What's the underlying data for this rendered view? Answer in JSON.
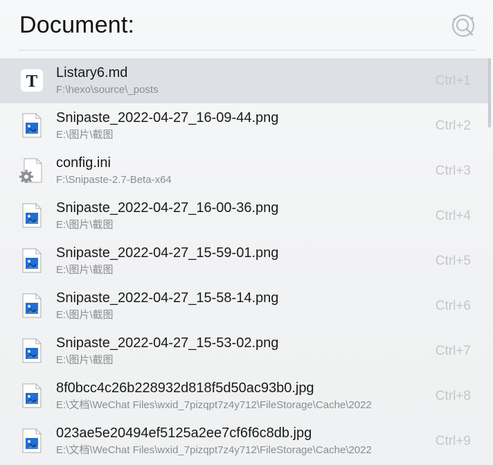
{
  "header": {
    "query_label": "Document:",
    "search_icon": "search-magnifier-icon"
  },
  "results": [
    {
      "name": "Listary6.md",
      "path": "F:\\hexo\\source\\_posts",
      "shortcut": "Ctrl+1",
      "icon": "text-file-icon",
      "selected": true
    },
    {
      "name": "Snipaste_2022-04-27_16-09-44.png",
      "path": "E:\\图片\\截图",
      "shortcut": "Ctrl+2",
      "icon": "image-file-icon"
    },
    {
      "name": "config.ini",
      "path": "F:\\Snipaste-2.7-Beta-x64",
      "shortcut": "Ctrl+3",
      "icon": "config-file-icon"
    },
    {
      "name": "Snipaste_2022-04-27_16-00-36.png",
      "path": "E:\\图片\\截图",
      "shortcut": "Ctrl+4",
      "icon": "image-file-icon"
    },
    {
      "name": "Snipaste_2022-04-27_15-59-01.png",
      "path": "E:\\图片\\截图",
      "shortcut": "Ctrl+5",
      "icon": "image-file-icon"
    },
    {
      "name": "Snipaste_2022-04-27_15-58-14.png",
      "path": "E:\\图片\\截图",
      "shortcut": "Ctrl+6",
      "icon": "image-file-icon"
    },
    {
      "name": "Snipaste_2022-04-27_15-53-02.png",
      "path": "E:\\图片\\截图",
      "shortcut": "Ctrl+7",
      "icon": "image-file-icon"
    },
    {
      "name": "8f0bcc4c26b228932d818f5d50ac93b0.jpg",
      "path": "E:\\文档\\WeChat Files\\wxid_7pizqpt7z4y712\\FileStorage\\Cache\\2022",
      "shortcut": "Ctrl+8",
      "icon": "image-file-icon"
    },
    {
      "name": "023ae5e20494ef5125a2ee7cf6f6c8db.jpg",
      "path": "E:\\文档\\WeChat Files\\wxid_7pizqpt7z4y712\\FileStorage\\Cache\\2022",
      "shortcut": "Ctrl+9",
      "icon": "image-file-icon"
    }
  ],
  "colors": {
    "selected_row": "#dde1e6",
    "path_text": "#8a8c8f",
    "shortcut_text": "#c4c6c9",
    "image_icon_blue": "#1f6fd6"
  }
}
